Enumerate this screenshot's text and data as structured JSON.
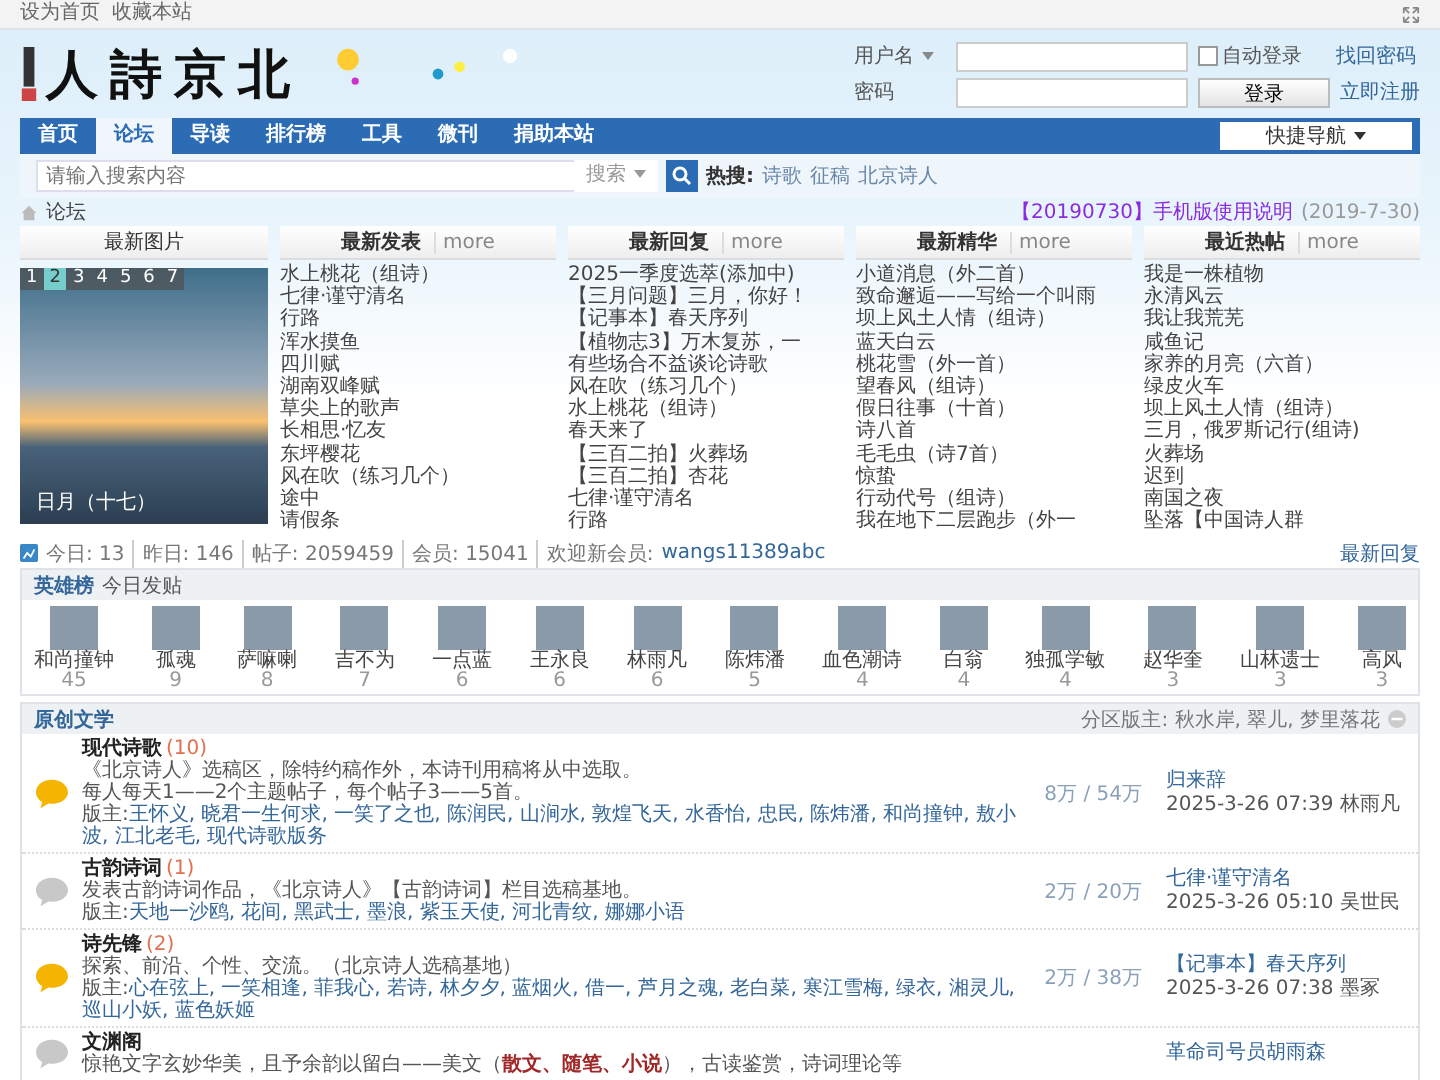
{
  "top_bar": {
    "links": [
      "设为首页",
      "收藏本站"
    ]
  },
  "logo": {
    "text": "人詩京北"
  },
  "login": {
    "username_label": "用户名",
    "auto_login": {
      "label": "自动登录",
      "checked": false
    },
    "forgot": "找回密码",
    "password_label": "密码",
    "submit": "登录",
    "register": "立即注册"
  },
  "nav": {
    "items": [
      {
        "label": "首页",
        "selected": false
      },
      {
        "label": "论坛",
        "selected": true
      },
      {
        "label": "导读",
        "selected": false
      },
      {
        "label": "排行榜",
        "selected": false
      },
      {
        "label": "工具",
        "selected": false
      },
      {
        "label": "微刊",
        "selected": false
      },
      {
        "label": "捐助本站",
        "selected": false
      }
    ],
    "quick_nav": "快捷导航"
  },
  "search": {
    "placeholder": "请输入搜索内容",
    "scope": "搜索",
    "hot_label": "热搜:",
    "hot": [
      "诗歌",
      "征稿",
      "北京诗人"
    ]
  },
  "breadcrumb": {
    "current": "论坛",
    "notice": "【20190730】手机版使用说明",
    "notice_date": "(2019-7-30)"
  },
  "slideshow": {
    "title": "最新图片",
    "pages": [
      {
        "label": "1",
        "selected": false
      },
      {
        "label": "2",
        "selected": true
      },
      {
        "label": "3",
        "selected": false
      },
      {
        "label": "4",
        "selected": false
      },
      {
        "label": "5",
        "selected": false
      },
      {
        "label": "6",
        "selected": false
      },
      {
        "label": "7",
        "selected": false
      }
    ],
    "caption": "日月（十七）"
  },
  "lists": [
    {
      "title": "最新发表",
      "more": "more",
      "items": [
        "水上桃花（组诗）",
        "七律·谨守清名",
        "行路",
        "浑水摸鱼",
        "四川赋",
        "湖南双峰赋",
        "草尖上的歌声",
        "长相思·忆友",
        "东坪樱花",
        "风在吹（练习几个）",
        "途中",
        "请假条"
      ]
    },
    {
      "title": "最新回复",
      "more": "more",
      "items": [
        "2025一季度选萃(添加中)",
        "【三月问题】三月，你好！",
        "【记事本】春天序列",
        "【植物志3】万木复苏，一",
        "有些场合不益谈论诗歌",
        "风在吹（练习几个）",
        "水上桃花（组诗）",
        "春天来了",
        "【三百二拍】火葬场",
        "【三百二拍】杏花",
        "七律·谨守清名",
        "行路"
      ]
    },
    {
      "title": "最新精华",
      "more": "more",
      "items": [
        "小道消息（外二首）",
        "致命邂逅——写给一个叫雨",
        "坝上风土人情（组诗）",
        "蓝天白云",
        "桃花雪（外一首）",
        "望春风（组诗）",
        "假日往事（十首）",
        "诗八首",
        "毛毛虫（诗7首）",
        "惊蛰",
        "行动代号（组诗）",
        "我在地下二层跑步（外一"
      ]
    },
    {
      "title": "最近热帖",
      "more": "more",
      "items": [
        "我是一株植物",
        "永清风云",
        "我让我荒芜",
        "咸鱼记",
        "家养的月亮（六首）",
        "绿皮火车",
        "坝上风土人情（组诗）",
        "三月，俄罗斯记行(组诗)",
        "火葬场",
        "迟到",
        "南国之夜",
        "坠落【中国诗人群"
      ]
    }
  ],
  "stats": {
    "items": [
      "今日: 13",
      "昨日: 146",
      "帖子: 2059459",
      "会员: 15041"
    ],
    "welcome_label": "欢迎新会员:",
    "new_member": "wangs11389abc",
    "latest_link": "最新回复"
  },
  "heroes": {
    "title": "英雄榜",
    "subtitle": "今日发贴",
    "users": [
      {
        "name": "和尚撞钟",
        "count": "45"
      },
      {
        "name": "孤魂",
        "count": "9"
      },
      {
        "name": "萨嘛喇",
        "count": "8"
      },
      {
        "name": "吉不为",
        "count": "7"
      },
      {
        "name": "一点蓝",
        "count": "6"
      },
      {
        "name": "王永良",
        "count": "6"
      },
      {
        "name": "林雨凡",
        "count": "6"
      },
      {
        "name": "陈炜潘",
        "count": "5"
      },
      {
        "name": "血色潮诗",
        "count": "4"
      },
      {
        "name": "白翁",
        "count": "4"
      },
      {
        "name": "独孤学敏",
        "count": "4"
      },
      {
        "name": "赵华奎",
        "count": "3"
      },
      {
        "name": "山林遗士",
        "count": "3"
      },
      {
        "name": "高风",
        "count": "3"
      }
    ]
  },
  "forums": {
    "title": "原创文学",
    "moderators": "分区版主: 秋水岸, 翠儿, 梦里落花",
    "rows": [
      {
        "name": "现代诗歌",
        "count": "(10)",
        "new": true,
        "description": [
          "《北京诗人》选稿区，除特约稿作外，本诗刊用稿将从中选取。",
          "每人每天1——2个主题帖子，每个帖子3——5首。"
        ],
        "mods_label": "版主:",
        "mods": "王怀义, 晓君一生何求, 一笑了之也, 陈润民, 山涧水, 敦煌飞天, 水香怡, 忠民, 陈炜潘, 和尚撞钟, 敖小波, 江北老毛, 现代诗歌版务",
        "stats": "8万 / 54万",
        "last_title": "归来辞",
        "last_meta": "2025-3-26 07:39 林雨凡"
      },
      {
        "name": "古韵诗词",
        "count": "(1)",
        "new": false,
        "description": [
          "发表古韵诗词作品，《北京诗人》【古韵诗词】栏目选稿基地。"
        ],
        "mods_label": "版主:",
        "mods": "天地一沙鸥, 花间, 黑武士, 墨浪, 紫玉天使, 河北青纹, 娜娜小语",
        "stats": "2万 / 20万",
        "last_title": "七律·谨守清名",
        "last_meta": "2025-3-26 05:10 吴世民"
      },
      {
        "name": "诗先锋",
        "count": "(2)",
        "new": true,
        "description": [
          "探索、前沿、个性、交流。（北京诗人选稿基地）"
        ],
        "mods_label": "版主:",
        "mods": "心在弦上, 一笑相逢, 菲我心, 若诗, 林夕夕, 蓝烟火, 借一, 芦月之魂, 老白菜, 寒江雪梅, 绿衣, 湘灵儿, 巡山小妖, 蓝色妖姬",
        "stats": "2万 / 38万",
        "last_title": "【记事本】春天序列",
        "last_meta": "2025-3-26 07:38 墨冢"
      },
      {
        "name": "文渊阁",
        "new": false,
        "description": [
          "惊艳文字玄妙华美，且予余韵以留白——美文（**散文、随笔、小说**），古读鉴赏，诗词理论等"
        ],
        "last_title": "革命司号员胡雨森"
      }
    ]
  }
}
